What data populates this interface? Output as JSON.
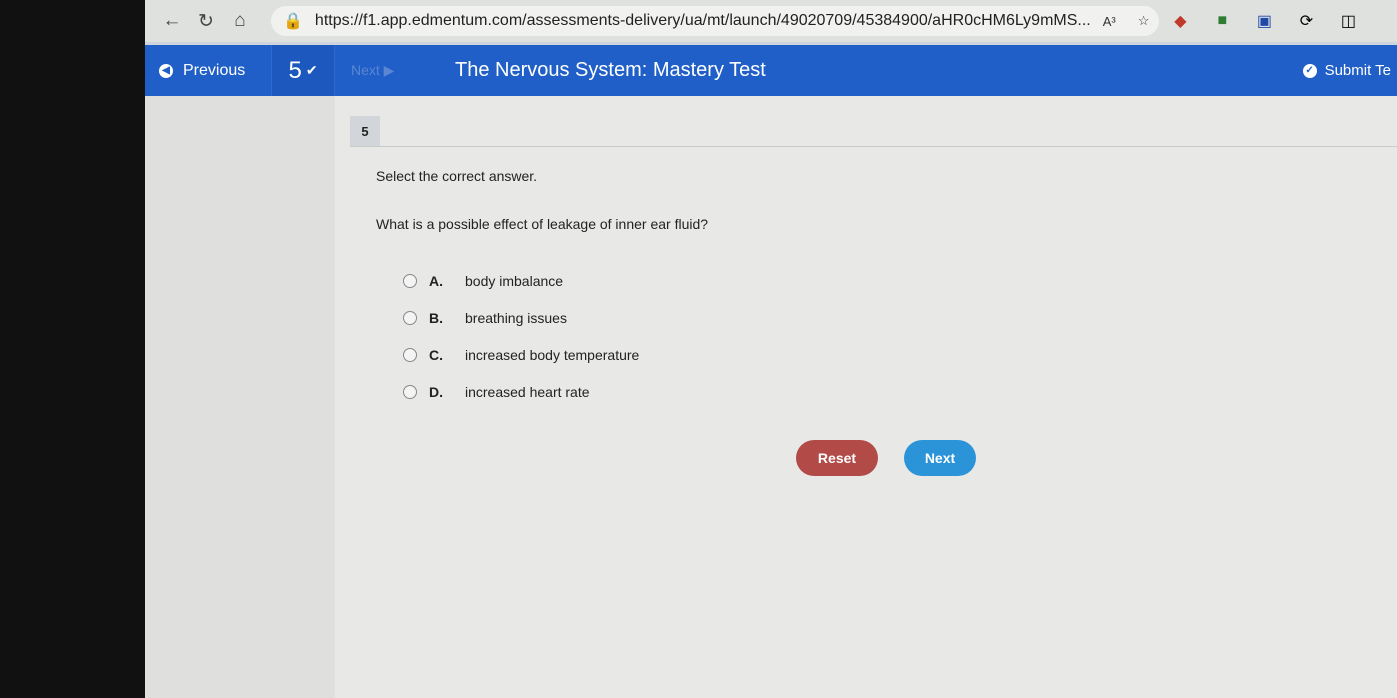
{
  "browser": {
    "url": "https://f1.app.edmentum.com/assessments-delivery/ua/mt/launch/49020709/45384900/aHR0cHM6Ly9mMS...",
    "read_aloud_label": "A³",
    "icons": [
      "back-icon",
      "refresh-icon",
      "home-icon",
      "lock-icon",
      "read-aloud-icon",
      "favorite-star-icon",
      "extension-icon",
      "profile-icon",
      "extension-c-icon",
      "copilot-icon",
      "split-screen-icon"
    ]
  },
  "toolbar": {
    "previous_label": "Previous",
    "question_number": "5",
    "next_label": "Next",
    "title": "The Nervous System: Mastery Test",
    "submit_label": "Submit Te",
    "color": "#1f5fc7"
  },
  "question": {
    "number": "5",
    "instruction": "Select the correct answer.",
    "text": "What is a possible effect of leakage of inner ear fluid?",
    "options": [
      {
        "letter": "A.",
        "text": "body imbalance"
      },
      {
        "letter": "B.",
        "text": "breathing issues"
      },
      {
        "letter": "C.",
        "text": "increased body temperature"
      },
      {
        "letter": "D.",
        "text": "increased heart rate"
      }
    ]
  },
  "buttons": {
    "reset": "Reset",
    "next": "Next",
    "reset_color": "#b24a48",
    "next_color": "#2b93d8"
  }
}
